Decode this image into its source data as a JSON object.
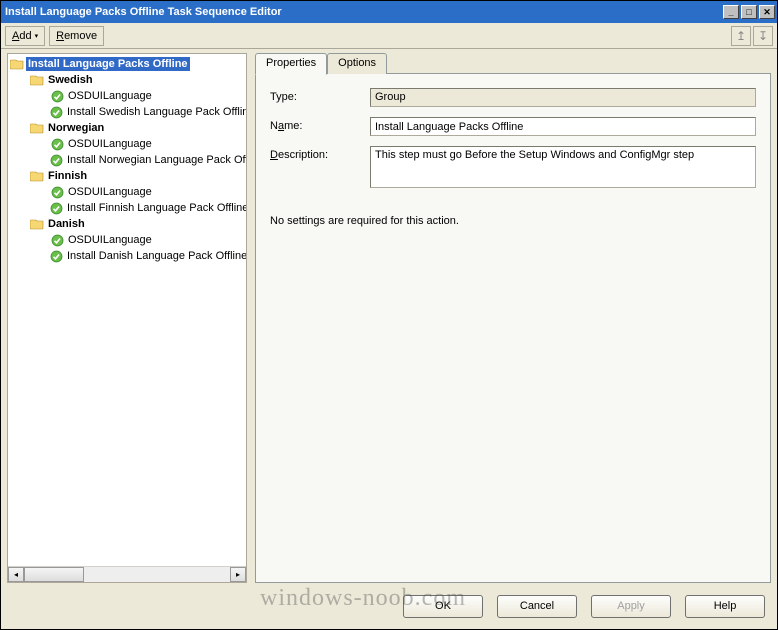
{
  "title": "Install Language Packs Offline Task Sequence Editor",
  "menu": {
    "add": "Add",
    "remove": "Remove"
  },
  "tree": {
    "root": "Install Language Packs Offline",
    "groups": [
      {
        "name": "Swedish",
        "items": [
          "OSDUILanguage",
          "Install Swedish Language Pack Offline"
        ]
      },
      {
        "name": "Norwegian",
        "items": [
          "OSDUILanguage",
          "Install Norwegian Language Pack Offline"
        ]
      },
      {
        "name": "Finnish",
        "items": [
          "OSDUILanguage",
          "Install Finnish Language Pack Offline"
        ]
      },
      {
        "name": "Danish",
        "items": [
          "OSDUILanguage",
          "Install Danish Language Pack Offline"
        ]
      }
    ]
  },
  "tabs": {
    "properties": "Properties",
    "options": "Options"
  },
  "form": {
    "type_label": "Type:",
    "type_value": "Group",
    "name_label_pre": "N",
    "name_label_u": "a",
    "name_label_post": "me:",
    "name_value": "Install Language Packs Offline",
    "desc_label_u": "D",
    "desc_label_post": "escription:",
    "desc_value": "This step must go Before the Setup Windows and ConfigMgr step",
    "info": "No settings are required  for this action."
  },
  "buttons": {
    "ok": "OK",
    "cancel": "Cancel",
    "apply": "Apply",
    "help": "Help"
  },
  "watermark": "windows-noob.com"
}
